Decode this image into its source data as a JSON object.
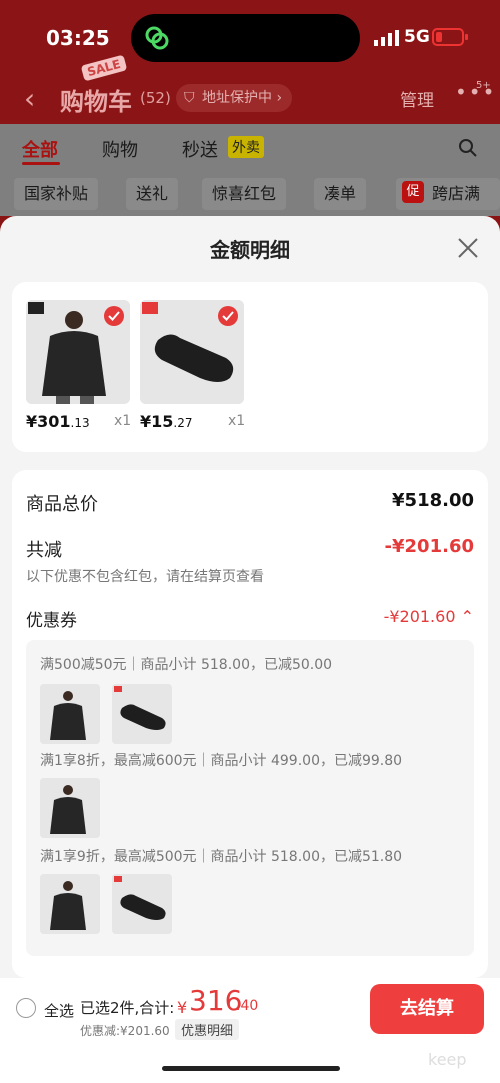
{
  "status": {
    "time": "03:25",
    "network": "5G"
  },
  "nav": {
    "title": "购物车",
    "count": "(52)",
    "sale_badge": "SALE",
    "address_protect": "地址保护中 ›",
    "manage": "管理",
    "more_badge": "5+"
  },
  "tabs": [
    {
      "label": "全部"
    },
    {
      "label": "购物"
    },
    {
      "label": "秒送"
    }
  ],
  "takeout_badge": "外卖",
  "chips": [
    {
      "label": "国家补贴"
    },
    {
      "label": "送礼"
    },
    {
      "label": "惊喜红包"
    },
    {
      "label": "凑单"
    },
    {
      "label": "跨店满减"
    }
  ],
  "promo_tag": "促",
  "sheet": {
    "title": "金额明细"
  },
  "items": [
    {
      "price_int": "¥301",
      "price_dec": ".13",
      "qty": "x1",
      "brand": "UNIQLO U"
    },
    {
      "price_int": "¥15",
      "price_dec": ".27",
      "qty": "x1",
      "brand": "UNIQLO"
    }
  ],
  "detail": {
    "total_label": "商品总价",
    "total_value": "¥518.00",
    "reduce_label": "共减",
    "reduce_value": "-¥201.60",
    "note": "以下优惠不包含红包，请在结算页查看",
    "coupon_label": "优惠券",
    "coupon_value": "-¥201.60 ⌃"
  },
  "coupon_rules": [
    {
      "text": "满500减50元｜商品小计 518.00，已减50.00"
    },
    {
      "text": "满1享8折，最高减600元｜商品小计 499.00，已减99.80"
    },
    {
      "text": "满1享9折，最高减500元｜商品小计 518.00，已减51.80"
    }
  ],
  "bottom": {
    "select_all": "全选",
    "selected_count": "已选2件,合计:",
    "total_symbol": "¥",
    "total_int": "316",
    "total_dec": ".40",
    "discount": "优惠减:¥201.60",
    "detail_chip": "优惠明细",
    "checkout": "去结算",
    "watermark": "keep"
  },
  "colors": {
    "accent": "#e43a3a",
    "header_bg": "#8b1516"
  }
}
